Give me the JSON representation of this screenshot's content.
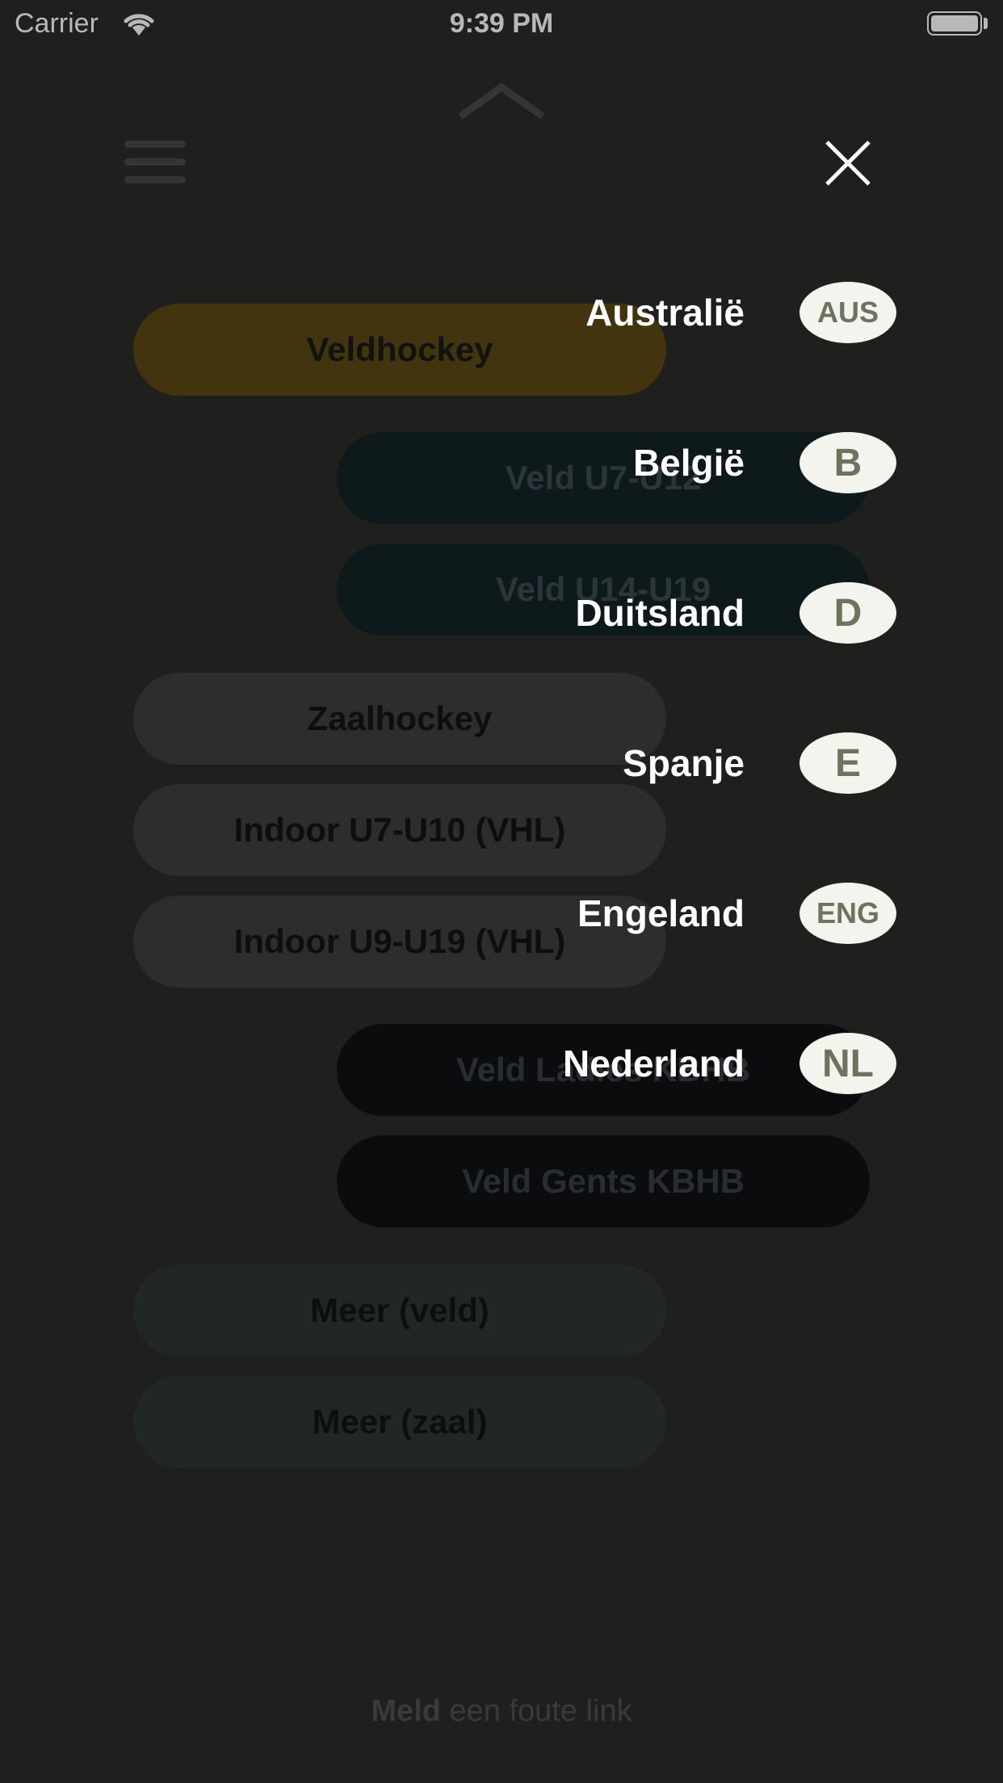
{
  "status_bar": {
    "carrier": "Carrier",
    "time": "9:39 PM"
  },
  "background": {
    "buttons": [
      {
        "label": "Veldhockey"
      },
      {
        "label": "Veld U7-U12"
      },
      {
        "label": "Veld U14-U19"
      },
      {
        "label": "Zaalhockey"
      },
      {
        "label": "Indoor U7-U10 (VHL)"
      },
      {
        "label": "Indoor U9-U19 (VHL)"
      },
      {
        "label": "Veld Ladies KBHB"
      },
      {
        "label": "Veld Gents KBHB"
      },
      {
        "label": "Meer (veld)"
      },
      {
        "label": "Meer (zaal)"
      }
    ],
    "footer": {
      "bold": "Meld",
      "rest": " een foute link"
    }
  },
  "country_menu": {
    "items": [
      {
        "name": "Australië",
        "code": "AUS"
      },
      {
        "name": "België",
        "code": "B"
      },
      {
        "name": "Duitsland",
        "code": "D"
      },
      {
        "name": "Spanje",
        "code": "E"
      },
      {
        "name": "Engeland",
        "code": "ENG"
      },
      {
        "name": "Nederland",
        "code": "NL"
      }
    ]
  },
  "icons": {
    "close": "close-icon",
    "menu": "hamburger-menu-icon",
    "collapse": "chevron-up-icon",
    "wifi": "wifi-icon",
    "battery": "battery-icon"
  },
  "colors": {
    "background": "#2b2d2a",
    "badge_bg": "#f4f4ef",
    "badge_text": "#6c745e",
    "gold": "#5a4816"
  }
}
